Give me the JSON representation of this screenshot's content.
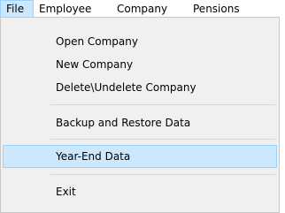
{
  "menubar": {
    "items": [
      {
        "label": "File"
      },
      {
        "label": "Employee"
      },
      {
        "label": "Company"
      },
      {
        "label": "Pensions"
      }
    ]
  },
  "file_menu": {
    "items": [
      {
        "label": "Open Company"
      },
      {
        "label": "New Company"
      },
      {
        "label": "Delete\\Undelete Company"
      },
      {
        "label": "Backup and Restore Data"
      },
      {
        "label": "Year-End Data"
      },
      {
        "label": "Exit"
      }
    ],
    "highlighted": "Year-End Data"
  },
  "colors": {
    "highlight_bg": "#cce8ff",
    "highlight_border": "#99d1ff",
    "menu_bg": "#f0f0f0"
  }
}
